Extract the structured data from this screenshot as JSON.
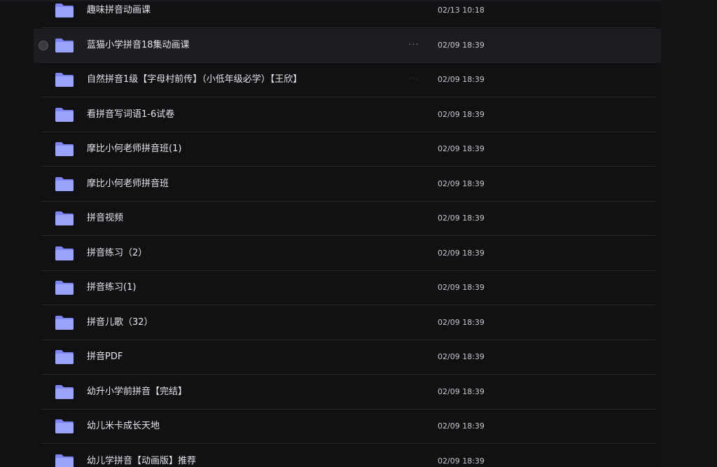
{
  "colors": {
    "background": "#111114",
    "hover_row": "#1d1d21",
    "folder": "#8b94f5",
    "text": "#e6e6ea",
    "date_text": "#c8c8cc"
  },
  "icons": {
    "folder": "folder-icon",
    "more": "more-horizontal-icon",
    "select": "radio-select-icon"
  },
  "rows": [
    {
      "name": "趣味拼音动画课",
      "date": "02/13 10:18",
      "more": "···"
    },
    {
      "name": "蓝猫小学拼音18集动画课",
      "date": "02/09 18:39",
      "more": "···",
      "state": "hovered"
    },
    {
      "name": "自然拼音1级【字母村前传】（小低年级必学）【王欣】",
      "date": "02/09 18:39",
      "more": "···"
    },
    {
      "name": "看拼音写词语1-6试卷",
      "date": "02/09 18:39",
      "more": "···"
    },
    {
      "name": "摩比小何老师拼音班(1)",
      "date": "02/09 18:39",
      "more": "···"
    },
    {
      "name": "摩比小何老师拼音班",
      "date": "02/09 18:39",
      "more": "···"
    },
    {
      "name": "拼音视频",
      "date": "02/09 18:39",
      "more": "···"
    },
    {
      "name": "拼音练习（2）",
      "date": "02/09 18:39",
      "more": "···"
    },
    {
      "name": "拼音练习(1)",
      "date": "02/09 18:39",
      "more": "···"
    },
    {
      "name": "拼音儿歌（32）",
      "date": "02/09 18:39",
      "more": "···"
    },
    {
      "name": "拼音PDF",
      "date": "02/09 18:39",
      "more": "···"
    },
    {
      "name": "幼升小学前拼音【完结】",
      "date": "02/09 18:39",
      "more": "···"
    },
    {
      "name": "幼儿米卡成长天地",
      "date": "02/09 18:39",
      "more": "···"
    },
    {
      "name": "幼儿学拼音【动画版】推荐",
      "date": "02/09 18:39",
      "more": "···"
    }
  ]
}
